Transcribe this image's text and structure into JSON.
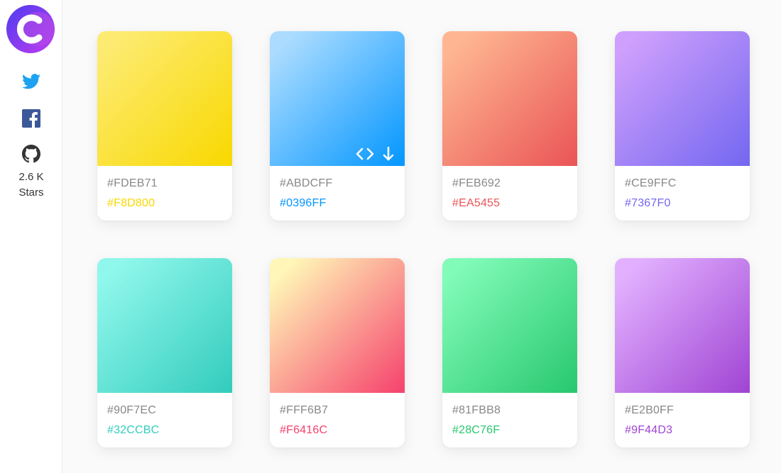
{
  "sidebar": {
    "logo_icon": "brand-logo-c-icon",
    "social": [
      {
        "name": "twitter",
        "icon": "twitter-icon",
        "color": "#1DA1F2"
      },
      {
        "name": "facebook",
        "icon": "facebook-icon",
        "color": "#3B5998"
      },
      {
        "name": "github",
        "icon": "github-icon",
        "color": "#333333"
      }
    ],
    "stars_count": "2.6 K",
    "stars_label": "Stars"
  },
  "cards": [
    {
      "start": "#FDEB71",
      "end": "#F8D800"
    },
    {
      "start": "#ABDCFF",
      "end": "#0396FF",
      "hover_actions": [
        "code-icon",
        "download-icon"
      ]
    },
    {
      "start": "#FEB692",
      "end": "#EA5455"
    },
    {
      "start": "#CE9FFC",
      "end": "#7367F0"
    },
    {
      "start": "#90F7EC",
      "end": "#32CCBC"
    },
    {
      "start": "#FFF6B7",
      "end": "#F6416C"
    },
    {
      "start": "#81FBB8",
      "end": "#28C76F"
    },
    {
      "start": "#E2B0FF",
      "end": "#9F44D3"
    }
  ]
}
